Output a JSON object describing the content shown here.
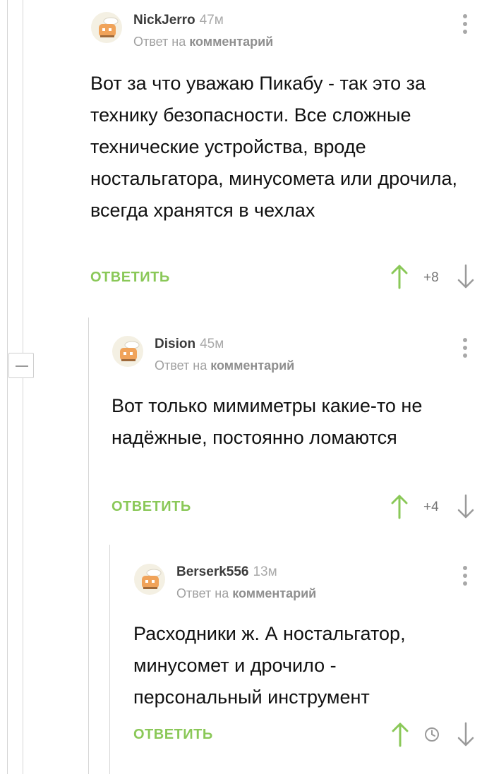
{
  "colors": {
    "accent_green": "#8ac858",
    "up_arrow": "#8ac858",
    "down_arrow": "#9a9a9a",
    "thread_line": "#d6d6d6",
    "text": "#111111",
    "meta": "#a0a0a0"
  },
  "thread": {
    "collapse_icon": "minus-icon"
  },
  "comments": [
    {
      "author": "NickJerro",
      "time": "47м",
      "reply_prefix": "Ответ на",
      "reply_link": "комментарий",
      "body": "Вот за что уважаю Пикабу - так это за технику безопасности. Все сложные технические устройства, вроде ностальгатора, минусомета или дрочила, всегда хранятся в чехлах",
      "reply_label": "ОТВЕТИТЬ",
      "rating": "+8",
      "icons": {
        "avatar": "chef-avatar-icon",
        "menu": "more-vertical-icon",
        "up": "arrow-up-icon",
        "down": "arrow-down-icon"
      }
    },
    {
      "author": "Dision",
      "time": "45м",
      "reply_prefix": "Ответ на",
      "reply_link": "комментарий",
      "body": "Вот только мимиметры какие-то не надёжные, постоянно ломаются",
      "reply_label": "ОТВЕТИТЬ",
      "rating": "+4",
      "icons": {
        "avatar": "chef-avatar-icon",
        "menu": "more-vertical-icon",
        "up": "arrow-up-icon",
        "down": "arrow-down-icon"
      }
    },
    {
      "author": "Berserk556",
      "time": "13м",
      "reply_prefix": "Ответ на",
      "reply_link": "комментарий",
      "body": "Расходники ж. А ностальгатор, минусомет и дрочило - персональный инструмент",
      "reply_label": "ОТВЕТИТЬ",
      "rating_icon": "clock-icon",
      "icons": {
        "avatar": "chef-avatar-icon",
        "menu": "more-vertical-icon",
        "up": "arrow-up-icon",
        "down": "arrow-down-icon"
      }
    }
  ]
}
